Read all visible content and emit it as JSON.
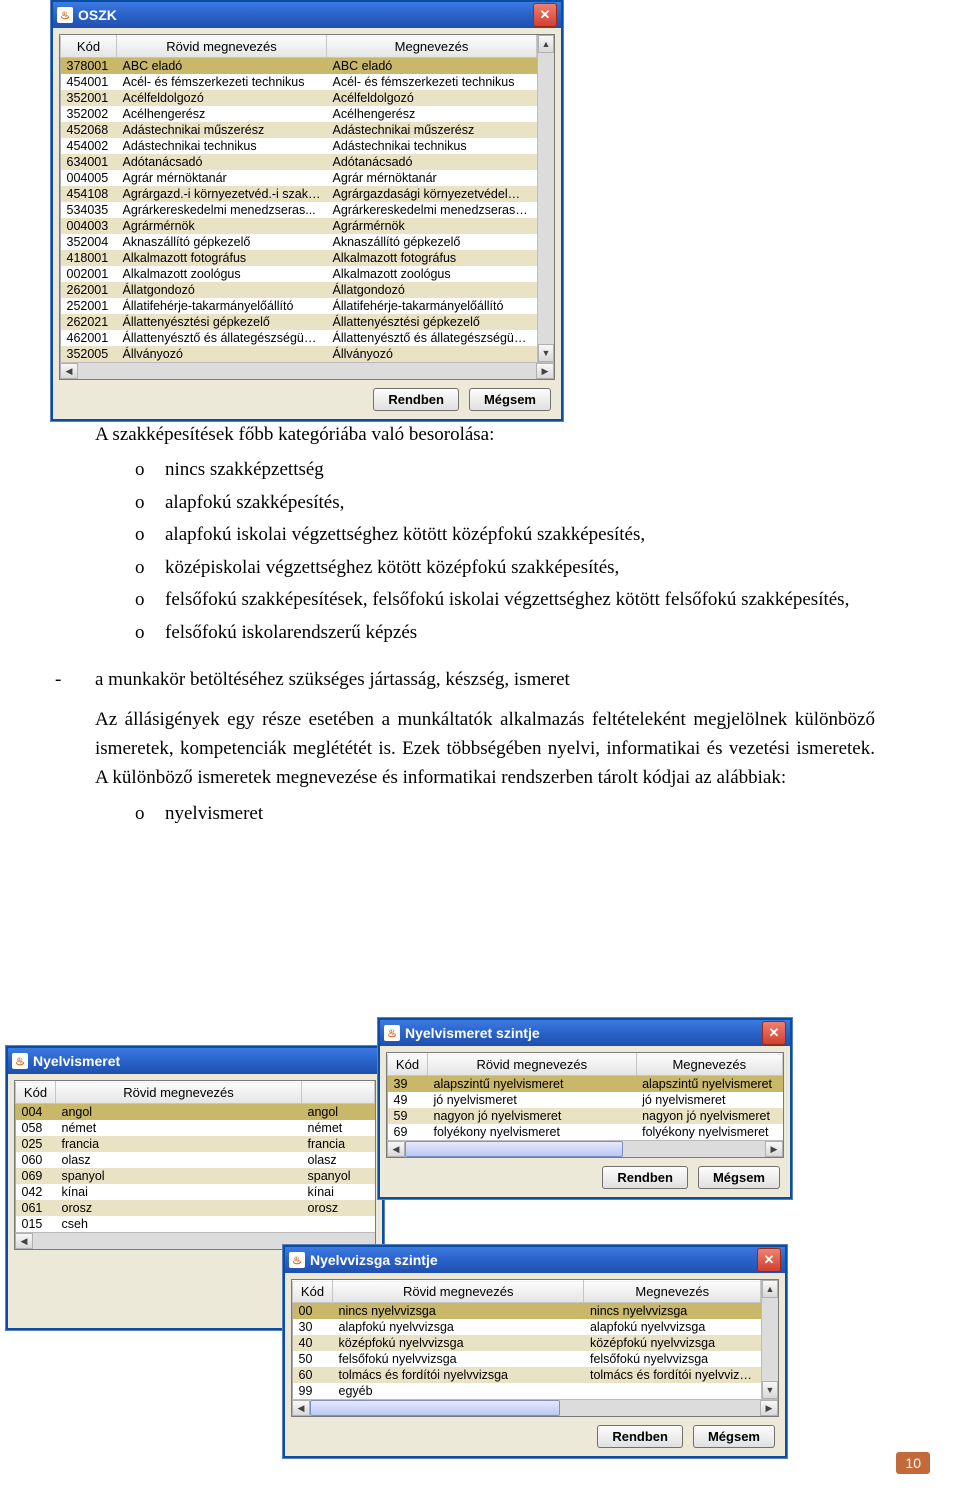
{
  "windows": {
    "oszk": {
      "title": "OSZK",
      "headers": [
        "Kód",
        "Rövid megnevezés",
        "Megnevezés"
      ],
      "rows": [
        [
          "378001",
          "ABC eladó",
          "ABC eladó"
        ],
        [
          "454001",
          "Acél- és fémszerkezeti technikus",
          "Acél- és fémszerkezeti technikus"
        ],
        [
          "352001",
          "Acélfeldolgozó",
          "Acélfeldolgozó"
        ],
        [
          "352002",
          "Acélhengerész",
          "Acélhengerész"
        ],
        [
          "452068",
          "Adástechnikai műszerész",
          "Adástechnikai műszerész"
        ],
        [
          "454002",
          "Adástechnikai technikus",
          "Adástechnikai technikus"
        ],
        [
          "634001",
          "Adótanácsadó",
          "Adótanácsadó"
        ],
        [
          "004005",
          "Agrár mérnöktanár",
          "Agrár mérnöktanár"
        ],
        [
          "454108",
          "Agrárgazd.-i környezetvéd.-i szakte...",
          "Agrárgazdasági környezetvédelmi szaktech..."
        ],
        [
          "534035",
          "Agrárkereskedelmi menedzseras...",
          "Agrárkereskedelmi menedzserasszisztens"
        ],
        [
          "004003",
          "Agrármérnök",
          "Agrármérnök"
        ],
        [
          "352004",
          "Aknaszállító gépkezelő",
          "Aknaszállító gépkezelő"
        ],
        [
          "418001",
          "Alkalmazott fotográfus",
          "Alkalmazott fotográfus"
        ],
        [
          "002001",
          "Alkalmazott zoológus",
          "Alkalmazott zoológus"
        ],
        [
          "262001",
          "Állatgondozó",
          "Állatgondozó"
        ],
        [
          "252001",
          "Állatifehérje-takarmányelőállító",
          "Állatifehérje-takarmányelőállító"
        ],
        [
          "262021",
          "Állattenyésztési gépkezelő",
          "Állattenyésztési gépkezelő"
        ],
        [
          "462001",
          "Állattenyésztő és állategészségüg...",
          "Állattenyésztő és állategészségügyi technik..."
        ],
        [
          "352005",
          "Állványozó",
          "Állványozó"
        ]
      ],
      "ok": "Rendben",
      "cancel": "Mégsem"
    },
    "nyelv": {
      "title": "Nyelvismeret",
      "headers": [
        "Kód",
        "Rövid megnevezés",
        ""
      ],
      "rows": [
        [
          "004",
          "angol",
          "angol"
        ],
        [
          "058",
          "német",
          "német"
        ],
        [
          "025",
          "francia",
          "francia"
        ],
        [
          "060",
          "olasz",
          "olasz"
        ],
        [
          "069",
          "spanyol",
          "spanyol"
        ],
        [
          "042",
          "kínai",
          "kínai"
        ],
        [
          "061",
          "orosz",
          "orosz"
        ],
        [
          "015",
          "cseh",
          ""
        ]
      ]
    },
    "nyelv_szint": {
      "title": "Nyelvismeret szintje",
      "headers": [
        "Kód",
        "Rövid megnevezés",
        "Megnevezés"
      ],
      "rows": [
        [
          "39",
          "alapszintű nyelvismeret",
          "alapszintű nyelvismeret"
        ],
        [
          "49",
          "jó nyelvismeret",
          "jó nyelvismeret"
        ],
        [
          "59",
          "nagyon jó nyelvismeret",
          "nagyon jó nyelvismeret"
        ],
        [
          "69",
          "folyékony nyelvismeret",
          "folyékony nyelvismeret"
        ]
      ],
      "ok": "Rendben",
      "cancel": "Mégsem"
    },
    "vizsga_szint": {
      "title": "Nyelvvizsga szintje",
      "headers": [
        "Kód",
        "Rövid megnevezés",
        "Megnevezés"
      ],
      "rows": [
        [
          "00",
          "nincs nyelvvizsga",
          "nincs nyelvvizsga"
        ],
        [
          "30",
          "alapfokú nyelvvizsga",
          "alapfokú nyelvvizsga"
        ],
        [
          "40",
          "középfokú nyelvvizsga",
          "középfokú nyelvvizsga"
        ],
        [
          "50",
          "felsőfokú nyelvvizsga",
          "felsőfokú nyelvvizsga"
        ],
        [
          "60",
          "tolmács és fordítói nyelvvizsga",
          "tolmács és fordítói nyelvvizsga"
        ],
        [
          "99",
          "egyéb",
          ""
        ]
      ],
      "ok": "Rendben",
      "cancel": "Mégsem"
    }
  },
  "doc": {
    "heading": "A szakképesítések főbb kategóriába való besorolása:",
    "bullets1": [
      "nincs szakképzettség",
      "alapfokú szakképesítés,",
      "alapfokú iskolai végzettséghez kötött középfokú szakképesítés,",
      "középiskolai végzettséghez kötött középfokú szakképesítés,",
      "felsőfokú szakképesítések, felsőfokú iskolai végzettséghez kötött felsőfokú szakképesítés,",
      "felsőfokú iskolarendszerű képzés"
    ],
    "dash_title": "a munkakör betöltéséhez szükséges jártasság, készség, ismeret",
    "para": "Az állásigények egy része esetében a munkáltatók alkalmazás feltételeként megjelölnek különböző ismeretek, kompetenciák meglététét is. Ezek többségében nyelvi, informatikai és vezetési ismeretek. A különböző ismeretek megnevezése és informatikai rendszerben tárolt kódjai az alábbiak:",
    "bullets2": [
      "nyelvismeret"
    ]
  },
  "page": "10"
}
